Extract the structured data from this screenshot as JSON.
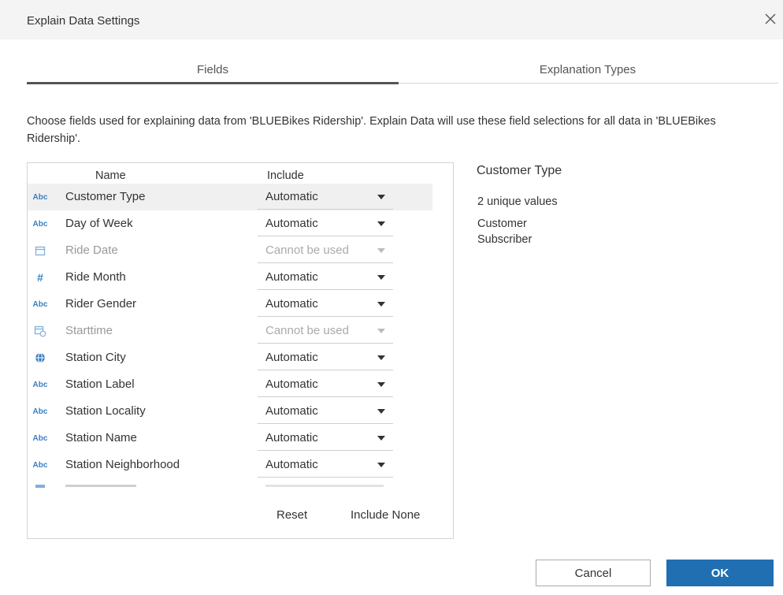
{
  "dialog": {
    "title": "Explain Data Settings"
  },
  "tabs": [
    {
      "label": "Fields"
    },
    {
      "label": "Explanation Types"
    }
  ],
  "description": "Choose fields used for explaining data from 'BLUEBikes Ridership'. Explain Data will use these field selections for all data in 'BLUEBikes Ridership'.",
  "table": {
    "headers": {
      "name": "Name",
      "include": "Include"
    },
    "rows": [
      {
        "icon": "Abc",
        "name": "Customer Type",
        "include": "Automatic"
      },
      {
        "icon": "Abc",
        "name": "Day of Week",
        "include": "Automatic"
      },
      {
        "icon": "calendar-icon",
        "name": "Ride Date",
        "include": "Cannot be used"
      },
      {
        "icon": "#",
        "name": "Ride Month",
        "include": "Automatic"
      },
      {
        "icon": "Abc",
        "name": "Rider Gender",
        "include": "Automatic"
      },
      {
        "icon": "calendar-clock-icon",
        "name": "Starttime",
        "include": "Cannot be used"
      },
      {
        "icon": "globe-icon",
        "name": "Station City",
        "include": "Automatic"
      },
      {
        "icon": "Abc",
        "name": "Station Label",
        "include": "Automatic"
      },
      {
        "icon": "Abc",
        "name": "Station Locality",
        "include": "Automatic"
      },
      {
        "icon": "Abc",
        "name": "Station Name",
        "include": "Automatic"
      },
      {
        "icon": "Abc",
        "name": "Station Neighborhood",
        "include": "Automatic"
      }
    ],
    "reset_label": "Reset",
    "include_none_label": "Include None"
  },
  "details": {
    "title": "Customer Type",
    "count": "2 unique values",
    "values": [
      "Customer",
      "Subscriber"
    ]
  },
  "buttons": {
    "cancel": "Cancel",
    "ok": "OK"
  },
  "colors": {
    "accent": "#1f6fb2",
    "icon": "#3a7fc4"
  }
}
